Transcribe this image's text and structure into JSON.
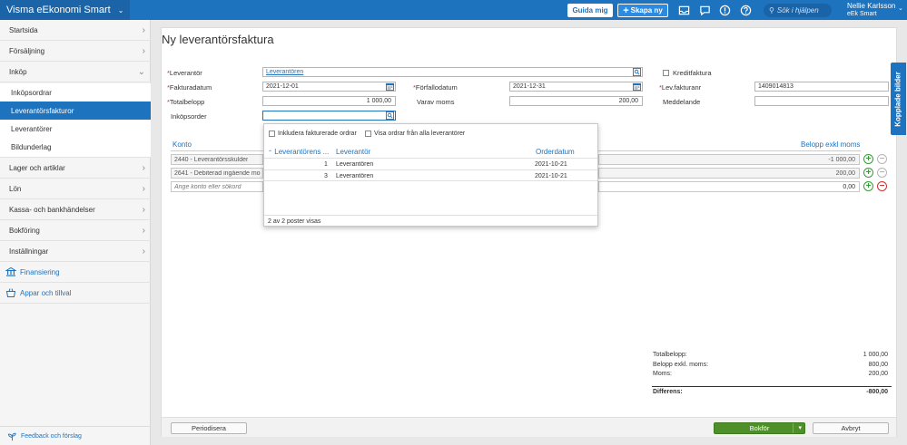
{
  "topbar": {
    "brand": "Visma eEkonomi Smart",
    "guida_label": "Guida mig",
    "skapa_label": "Skapa ny",
    "search_placeholder": "Sök i hjälpen",
    "user_name": "Nellie Karlsson",
    "user_company": "eEk Smart"
  },
  "sidebar": {
    "items": [
      {
        "label": "Startsida"
      },
      {
        "label": "Försäljning"
      },
      {
        "label": "Inköp"
      },
      {
        "label": "Lager och artiklar"
      },
      {
        "label": "Lön"
      },
      {
        "label": "Kassa- och bankhändelser"
      },
      {
        "label": "Bokföring"
      },
      {
        "label": "Inställningar"
      }
    ],
    "sub_items": [
      {
        "label": "Inköpsordrar"
      },
      {
        "label": "Leverantörsfakturor"
      },
      {
        "label": "Leverantörer"
      },
      {
        "label": "Bildunderlag"
      }
    ],
    "finansiering": "Finansiering",
    "appar": "Appar och tillval",
    "feedback": "Feedback och förslag"
  },
  "page": {
    "title": "Ny leverantörsfaktura"
  },
  "form": {
    "leverantor_label": "Leverantör",
    "leverantor_value": "Leverantören",
    "kreditfaktura_label": "Kreditfaktura",
    "fakturadatum_label": "Fakturadatum",
    "fakturadatum_value": "2021-12-01",
    "forfallodatum_label": "Förfallodatum",
    "forfallodatum_value": "2021-12-31",
    "levfakturanr_label": "Lev.fakturanr",
    "levfakturanr_value": "1409014813",
    "totalbelopp_label": "Totalbelopp",
    "totalbelopp_value": "1 000,00",
    "varav_moms_label": "Varav moms",
    "varav_moms_value": "200,00",
    "meddelande_label": "Meddelande",
    "inkopsorder_label": "Inköpsorder"
  },
  "table": {
    "konto_header": "Konto",
    "belopp_header": "Belopp exkl moms",
    "rows": [
      {
        "konto": "2440 - Leverantörsskulder",
        "belopp": "-1 000,00"
      },
      {
        "konto": "2641 - Debiterad ingående mo",
        "belopp": "200,00"
      }
    ],
    "new_row_placeholder": "Ange konto eller sökord",
    "new_row_belopp": "0,00"
  },
  "popup": {
    "opt1": "Inkludera fakturerade ordrar",
    "opt2": "Visa ordrar från alla leverantörer",
    "col1": "Leverantörens ...",
    "col2": "Leverantör",
    "col3": "Orderdatum",
    "rows": [
      {
        "nr": "1",
        "leverantor": "Leverantören",
        "datum": "2021-10-21"
      },
      {
        "nr": "3",
        "leverantor": "Leverantören",
        "datum": "2021-10-21"
      }
    ],
    "footer": "2 av 2 poster visas"
  },
  "totals": {
    "totalbelopp_label": "Totalbelopp:",
    "totalbelopp_value": "1 000,00",
    "belopp_exkl_label": "Belopp exkl. moms:",
    "belopp_exkl_value": "800,00",
    "moms_label": "Moms:",
    "moms_value": "200,00",
    "differens_label": "Differens:",
    "differens_value": "-800,00"
  },
  "footer": {
    "periodisera": "Periodisera",
    "bokfor": "Bokför",
    "avbryt": "Avbryt"
  },
  "sidetab": {
    "label": "Kopplade bilder"
  },
  "colors": {
    "brand": "#1e73be",
    "green": "#4e8f2a",
    "required": "#c0392b"
  }
}
